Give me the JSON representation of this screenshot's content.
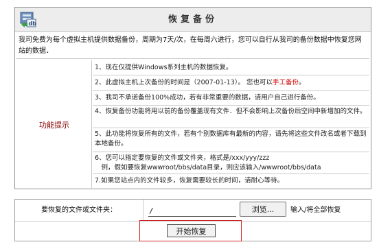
{
  "header": {
    "title": "恢复备份",
    "icon": "database-restore-icon"
  },
  "intro": "我司免费为每个虚拟主机提供数据备份，周期为7天/次，在每周六进行，您可以自行从我司的备份数据中恢复您网站的数据．",
  "features": {
    "label": "功能提示",
    "items": [
      {
        "text": "1、现在仅提供Windows系列主机的数据恢复。"
      },
      {
        "text": "2、此虚拟主机上次备份的时间是（2007-01-13）。 您也可以",
        "link": "手工备份",
        "tail": "。"
      },
      {
        "text": "3、我司不承诺备份100%成功，若有非常重要的数据，请用户自己进行备份。"
      },
      {
        "text": "4、恢复备份功能将用以前的备份覆盖现有文件．但不会影响上次备份后空间中新增加的文件。"
      },
      {
        "text": "5、此功能将恢复所有的文件，若有个别数据库有最新的内容，请先将这些文件改名或者下载到本地备份。"
      },
      {
        "text": "6、您可以指定要恢复的文件或文件夹，格式是/xxx/yyy/zzz",
        "line2": "　例，假如要恢复wwwroot/bbs/data目录，则应该输入/wwwroot/bbs/data"
      },
      {
        "text": "7.如果您站点内的文件较多，恢复需要较长的时间，请耐心等待。"
      }
    ]
  },
  "form": {
    "path_label": "要恢复的文件或文件夹：",
    "path_value": "/",
    "browse_label": "浏览...",
    "hint": "输入/将全部恢复",
    "start_label": "开始恢复"
  },
  "colors": {
    "header_bg": "#ededed",
    "label_color": "#8b0000",
    "link_color": "#d00000",
    "highlight_border": "#d02020"
  }
}
